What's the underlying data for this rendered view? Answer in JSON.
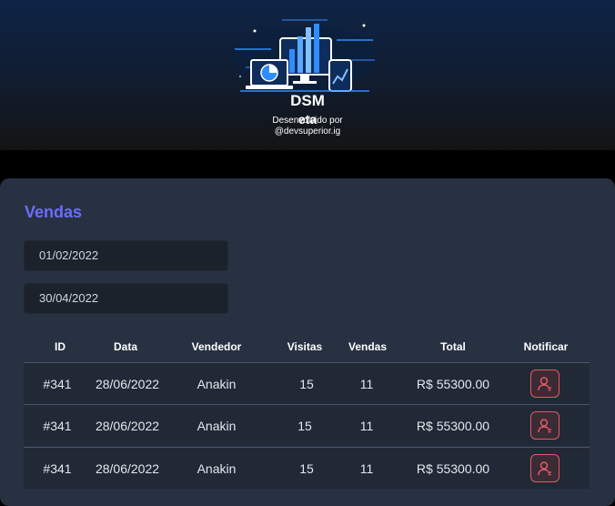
{
  "header": {
    "brand": "DSM",
    "credit_line1": "Desenvolvido por",
    "credit_overlay": "eta",
    "credit_line2": "@devsuperior.ig"
  },
  "sales": {
    "title": "Vendas",
    "date_start": "01/02/2022",
    "date_end": "30/04/2022",
    "columns": [
      "ID",
      "Data",
      "Vendedor",
      "Visitas",
      "Vendas",
      "Total",
      "Notificar"
    ],
    "rows": [
      {
        "id": "#341",
        "date": "28/06/2022",
        "seller": "Anakin",
        "visits": "15",
        "deals": "11",
        "total": "R$ 55300.00"
      },
      {
        "id": "#341",
        "date": "28/06/2022",
        "seller": "Anakin",
        "visits": "15",
        "deals": "11",
        "total": "R$ 55300.00"
      },
      {
        "id": "#341",
        "date": "28/06/2022",
        "seller": "Anakin",
        "visits": "15",
        "deals": "11",
        "total": "R$ 55300.00"
      }
    ]
  },
  "colors": {
    "accent": "#6c6dff",
    "notify": "#e35b67",
    "card": "#283142",
    "row": "#202935"
  },
  "icons": {
    "logo": "dashboard-illustration-icon",
    "notify": "bell-user-icon"
  }
}
